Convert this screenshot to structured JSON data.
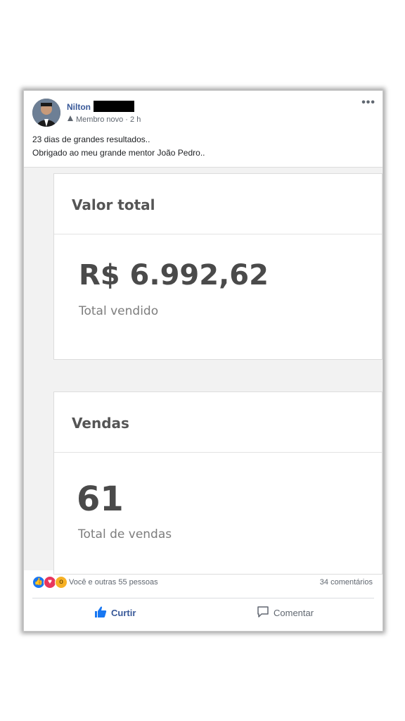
{
  "post": {
    "author": "Nilton",
    "meta": "Membro novo · 2 h",
    "caption_line1": "23 dias de grandes resultados..",
    "caption_line2": "Obrigado ao meu grande mentor João Pedro..",
    "more_icon": "more-dots-icon"
  },
  "screenshot": {
    "card1": {
      "title": "Valor total",
      "value": "R$ 6.992,62",
      "subtitle": "Total vendido"
    },
    "card2": {
      "title": "Vendas",
      "value": "61",
      "subtitle": "Total de vendas"
    }
  },
  "reactions": {
    "text": "Você e outras 55 pessoas",
    "comments": "34 comentários",
    "icons": [
      "like-icon",
      "love-icon",
      "wow-icon"
    ]
  },
  "actions": {
    "like_label": "Curtir",
    "comment_label": "Comentar"
  },
  "colors": {
    "link_blue": "#385898",
    "like_blue": "#1877f2"
  }
}
